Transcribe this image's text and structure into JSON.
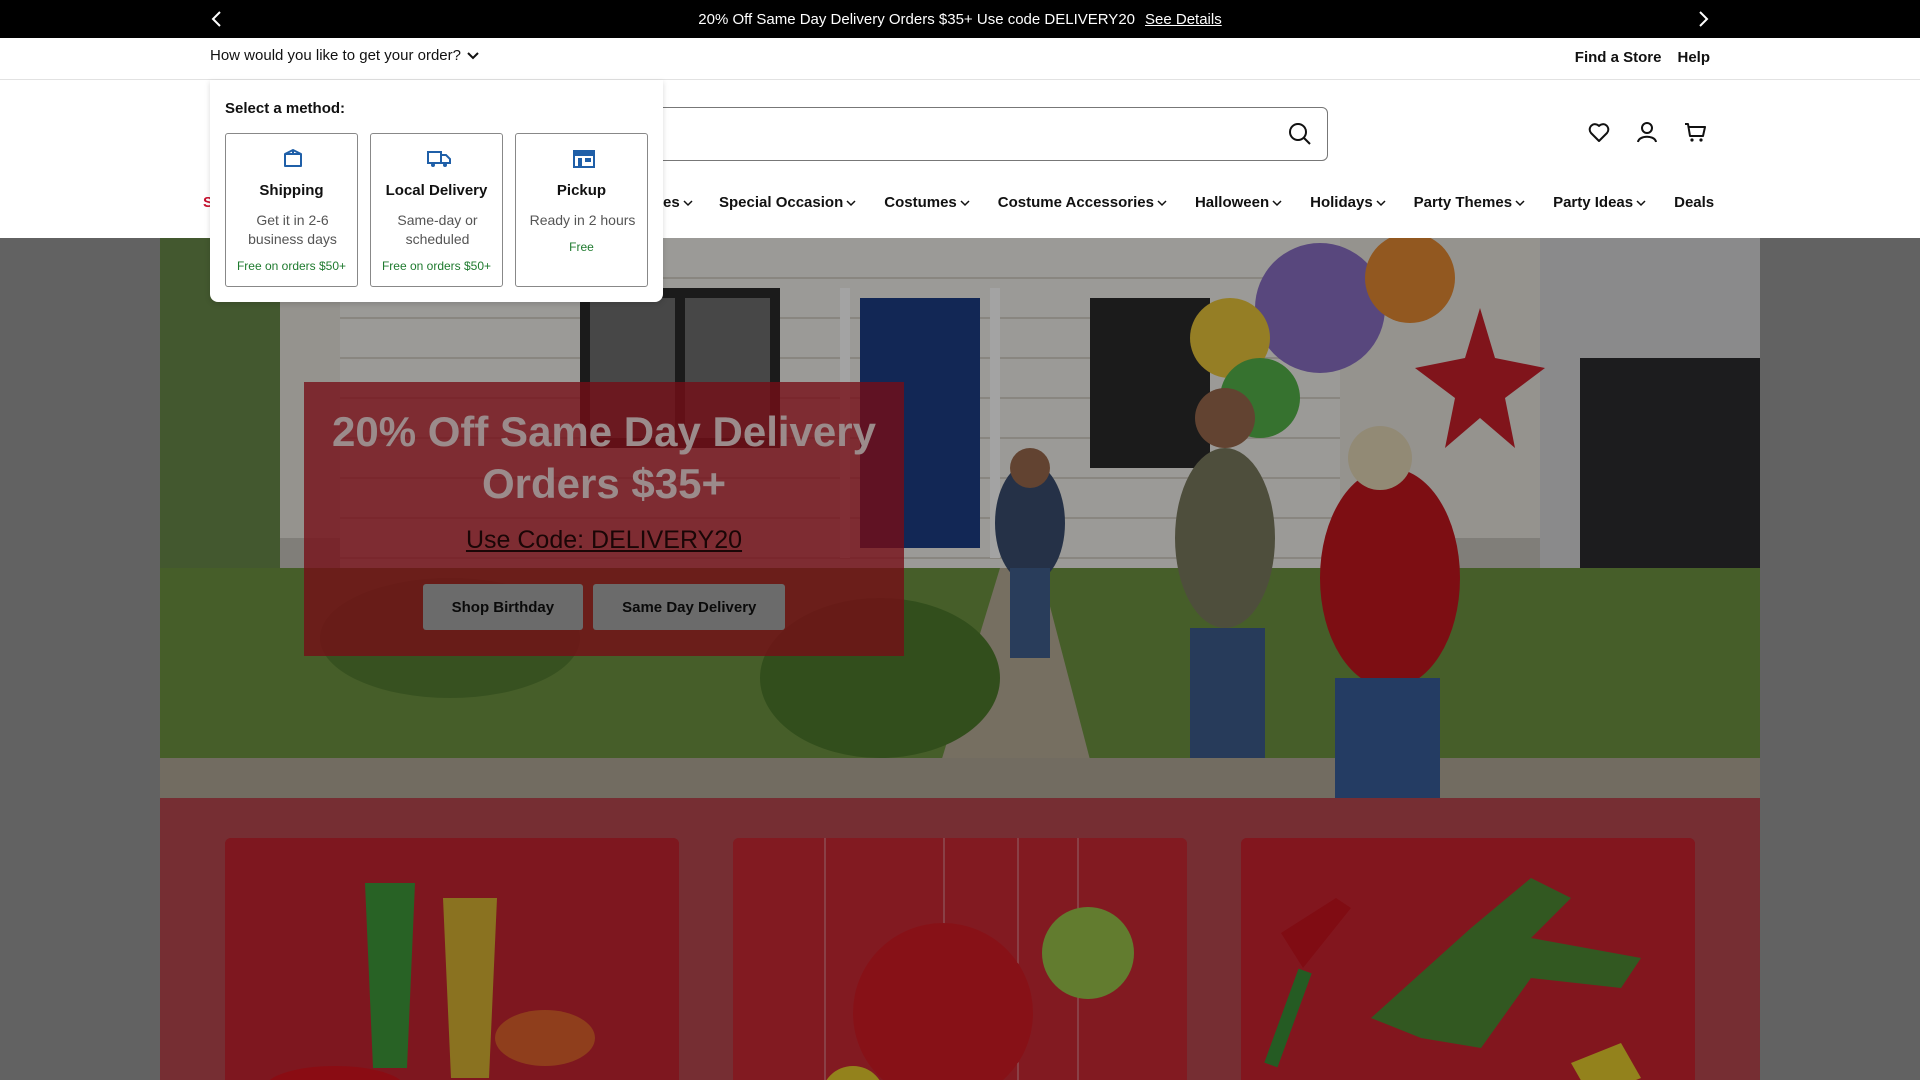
{
  "promo": {
    "text": "20% Off Same Day Delivery Orders $35+ Use code DELIVERY20",
    "details_link": "See Details",
    "prev_icon": "chevron-left-icon",
    "next_icon": "chevron-right-icon"
  },
  "order_method": {
    "question": "How would you like to get your order?",
    "toggle_icon": "chevron-down-icon"
  },
  "top_links": {
    "find_store": "Find a Store",
    "help": "Help"
  },
  "search": {
    "placeholder": "",
    "icon": "search-icon"
  },
  "header_icons": [
    "heart-icon",
    "user-icon",
    "cart-icon"
  ],
  "nav": {
    "partial_label": "S",
    "partial_label_2": "es",
    "items": [
      {
        "label": "Special Occasion"
      },
      {
        "label": "Costumes"
      },
      {
        "label": "Costume Accessories"
      },
      {
        "label": "Halloween"
      },
      {
        "label": "Holidays"
      },
      {
        "label": "Party Themes"
      },
      {
        "label": "Party Ideas"
      },
      {
        "label": "Deals"
      }
    ]
  },
  "popup": {
    "title": "Select a method:",
    "methods": [
      {
        "icon": "box-icon",
        "name": "Shipping",
        "desc": "Get it in 2-6 business days",
        "note": "Free on orders $50+"
      },
      {
        "icon": "truck-icon",
        "name": "Local Delivery",
        "desc": "Same-day or scheduled",
        "note": "Free on orders $50+"
      },
      {
        "icon": "store-icon",
        "name": "Pickup",
        "desc": "Ready in 2 hours",
        "note": "Free"
      }
    ]
  },
  "hero": {
    "title_line1": "20% Off Same Day Delivery",
    "title_line2": "Orders $35+",
    "code": "Use Code: DELIVERY20",
    "btn_birthday": "Shop Birthday",
    "btn_delivery": "Same Day Delivery"
  },
  "colors": {
    "brand_red": "#c8102e",
    "promo_bg": "#000000",
    "free_green": "#1e7a2e",
    "method_icon_blue": "#1f5fa8"
  }
}
